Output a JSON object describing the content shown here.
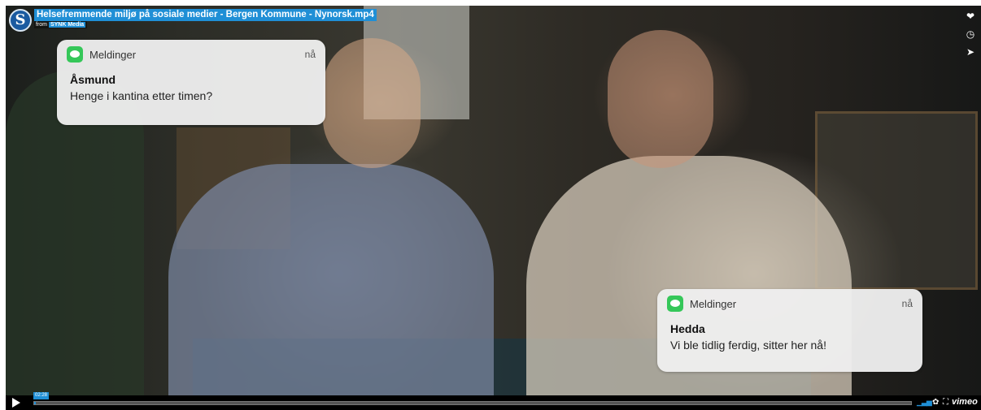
{
  "player": {
    "title": "Helsefremmende miljø på sosiale medier - Bergen Kommune - Nynorsk.mp4",
    "byline_prefix": "from",
    "author": "SYNK Media",
    "logo_letter": "S"
  },
  "side_actions": [
    {
      "name": "like-icon",
      "glyph": "❤"
    },
    {
      "name": "watch-later-icon",
      "glyph": "◷"
    },
    {
      "name": "share-icon",
      "glyph": "➤"
    }
  ],
  "notifications": [
    {
      "app": "Meldinger",
      "time": "nå",
      "sender": "Åsmund",
      "message": "Henge i kantina etter timen?"
    },
    {
      "app": "Meldinger",
      "time": "nå",
      "sender": "Hedda",
      "message": "Vi ble tidlig ferdig, sitter her nå!"
    }
  ],
  "controls": {
    "play_glyph": "",
    "current_time": "02:28",
    "progress_fraction": 0.002,
    "volume_glyph": "▁▃▅",
    "settings_glyph": "✿",
    "fullscreen_glyph": "⛶",
    "brand": "vimeo"
  },
  "colors": {
    "accent": "#1f8fd6",
    "messages_green": "#35c759"
  }
}
